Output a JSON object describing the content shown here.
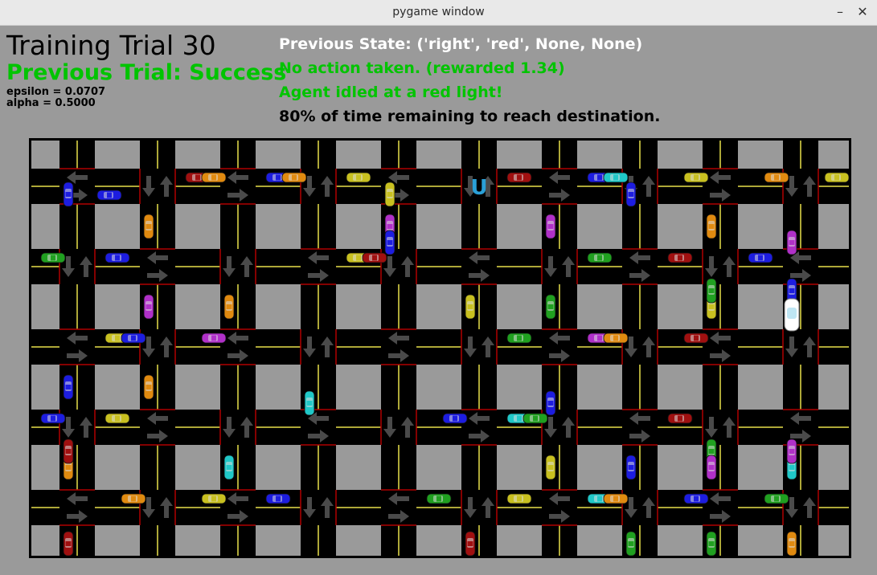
{
  "window": {
    "title": "pygame window",
    "minimize_glyph": "–",
    "close_glyph": "✕"
  },
  "hud": {
    "trial_title": "Training Trial 30",
    "previous_trial": "Previous Trial: Success",
    "epsilon": "epsilon = 0.0707",
    "alpha": "alpha = 0.5000",
    "previous_state": "Previous State: ('right', 'red', None, None)",
    "action": "No action taken. (rewarded 1.34)",
    "reason": "Agent idled at a red light!",
    "time_remaining": "80% of time remaining to reach destination."
  },
  "colors": {
    "background": "#9a9a9a",
    "road": "#000000",
    "lane_line": "#e8e04a",
    "signal_red": "#b00000",
    "success_green": "#00c400",
    "white_text": "#ffffff",
    "destination": "#2a9fd6"
  },
  "icons": {
    "destination": "udacity-logo-icon",
    "agent": "white-agent-car-icon",
    "traffic_arrow": "arrow-icon"
  },
  "world": {
    "columns": 10,
    "rows": 5,
    "agent_facing": "south",
    "destination_marker": "U"
  },
  "cars": [
    {
      "color": "#1d1de0",
      "dir": "v",
      "road": 0,
      "cross": 0.6
    },
    {
      "color": "#c8c020",
      "dir": "v",
      "road": 4,
      "cross": 0.6
    },
    {
      "color": "#1d1de0",
      "dir": "v",
      "road": 7,
      "cross": 0.6
    },
    {
      "color": "#1d1de0",
      "dir": "h",
      "road": 0,
      "cross": 0.9
    },
    {
      "color": "#a01010",
      "dir": "h",
      "road": 0,
      "cross": 2.0
    },
    {
      "color": "#1d1de0",
      "dir": "h",
      "road": 0,
      "cross": 3.0
    },
    {
      "color": "#c8c020",
      "dir": "h",
      "road": 0,
      "cross": 4.0
    },
    {
      "color": "#a01010",
      "dir": "h",
      "road": 0,
      "cross": 6.0
    },
    {
      "color": "#1d1de0",
      "dir": "h",
      "road": 0,
      "cross": 7.0
    },
    {
      "color": "#c8c020",
      "dir": "h",
      "road": 0,
      "cross": 10.0
    },
    {
      "color": "#e08a10",
      "dir": "h",
      "road": 0,
      "cross": 2.2
    },
    {
      "color": "#e08a10",
      "dir": "h",
      "road": 0,
      "cross": 3.2
    },
    {
      "color": "#20c8c8",
      "dir": "h",
      "road": 0,
      "cross": 7.2
    },
    {
      "color": "#c8c020",
      "dir": "h",
      "road": 0,
      "cross": 8.2
    },
    {
      "color": "#e08a10",
      "dir": "h",
      "road": 0,
      "cross": 9.2
    },
    {
      "color": "#e08a10",
      "dir": "v",
      "road": 1,
      "cross": 1.0
    },
    {
      "color": "#b030c8",
      "dir": "v",
      "road": 4,
      "cross": 1.0
    },
    {
      "color": "#1d1de0",
      "dir": "v",
      "road": 4,
      "cross": 1.2
    },
    {
      "color": "#b030c8",
      "dir": "v",
      "road": 6,
      "cross": 1.0
    },
    {
      "color": "#e08a10",
      "dir": "v",
      "road": 8,
      "cross": 1.0
    },
    {
      "color": "#b030c8",
      "dir": "v",
      "road": 9,
      "cross": 1.2
    },
    {
      "color": "#1d1de0",
      "dir": "h",
      "road": 1,
      "cross": 1.0
    },
    {
      "color": "#c8c020",
      "dir": "h",
      "road": 1,
      "cross": 4.0
    },
    {
      "color": "#20a020",
      "dir": "h",
      "road": 1,
      "cross": 7.0
    },
    {
      "color": "#a01010",
      "dir": "h",
      "road": 1,
      "cross": 8.0
    },
    {
      "color": "#1d1de0",
      "dir": "h",
      "road": 1,
      "cross": 9.0
    },
    {
      "color": "#20a020",
      "dir": "h",
      "road": 1,
      "cross": 0.2
    },
    {
      "color": "#a01010",
      "dir": "h",
      "road": 1,
      "cross": 4.2
    },
    {
      "color": "#b030c8",
      "dir": "v",
      "road": 1,
      "cross": 2.0
    },
    {
      "color": "#e08a10",
      "dir": "v",
      "road": 2,
      "cross": 2.0
    },
    {
      "color": "#c8c020",
      "dir": "v",
      "road": 5,
      "cross": 2.0
    },
    {
      "color": "#20a020",
      "dir": "v",
      "road": 6,
      "cross": 2.0
    },
    {
      "color": "#c8c020",
      "dir": "v",
      "road": 8,
      "cross": 2.0
    },
    {
      "color": "#20a020",
      "dir": "v",
      "road": 8,
      "cross": 1.8
    },
    {
      "color": "#1d1de0",
      "dir": "v",
      "road": 9,
      "cross": 1.8
    },
    {
      "color": "#c8c020",
      "dir": "h",
      "road": 2,
      "cross": 1.0
    },
    {
      "color": "#20a020",
      "dir": "h",
      "road": 2,
      "cross": 6.0
    },
    {
      "color": "#b030c8",
      "dir": "h",
      "road": 2,
      "cross": 7.0
    },
    {
      "color": "#1d1de0",
      "dir": "h",
      "road": 2,
      "cross": 1.2
    },
    {
      "color": "#b030c8",
      "dir": "h",
      "road": 2,
      "cross": 2.2
    },
    {
      "color": "#e08a10",
      "dir": "h",
      "road": 2,
      "cross": 7.2
    },
    {
      "color": "#a01010",
      "dir": "h",
      "road": 2,
      "cross": 8.2
    },
    {
      "color": "#1d1de0",
      "dir": "v",
      "road": 0,
      "cross": 3.0
    },
    {
      "color": "#e08a10",
      "dir": "v",
      "road": 1,
      "cross": 3.0
    },
    {
      "color": "#20c8c8",
      "dir": "v",
      "road": 3,
      "cross": 3.2
    },
    {
      "color": "#1d1de0",
      "dir": "v",
      "road": 6,
      "cross": 3.2
    },
    {
      "color": "#c8c020",
      "dir": "h",
      "road": 3,
      "cross": 1.0
    },
    {
      "color": "#20c8c8",
      "dir": "h",
      "road": 3,
      "cross": 6.0
    },
    {
      "color": "#a01010",
      "dir": "h",
      "road": 3,
      "cross": 8.0
    },
    {
      "color": "#1d1de0",
      "dir": "h",
      "road": 3,
      "cross": 0.2
    },
    {
      "color": "#1d1de0",
      "dir": "h",
      "road": 3,
      "cross": 5.2
    },
    {
      "color": "#20a020",
      "dir": "h",
      "road": 3,
      "cross": 6.2
    },
    {
      "color": "#e08a10",
      "dir": "v",
      "road": 0,
      "cross": 4.0
    },
    {
      "color": "#a01010",
      "dir": "v",
      "road": 0,
      "cross": 3.8
    },
    {
      "color": "#20c8c8",
      "dir": "v",
      "road": 2,
      "cross": 4.0
    },
    {
      "color": "#c8c020",
      "dir": "v",
      "road": 6,
      "cross": 4.0
    },
    {
      "color": "#1d1de0",
      "dir": "v",
      "road": 7,
      "cross": 4.0
    },
    {
      "color": "#20a020",
      "dir": "v",
      "road": 8,
      "cross": 3.8
    },
    {
      "color": "#b030c8",
      "dir": "v",
      "road": 8,
      "cross": 4.0
    },
    {
      "color": "#20c8c8",
      "dir": "v",
      "road": 9,
      "cross": 4.0
    },
    {
      "color": "#b030c8",
      "dir": "v",
      "road": 9,
      "cross": 3.8
    },
    {
      "color": "#1d1de0",
      "dir": "h",
      "road": 4,
      "cross": 3.0
    },
    {
      "color": "#20a020",
      "dir": "h",
      "road": 4,
      "cross": 5.0
    },
    {
      "color": "#c8c020",
      "dir": "h",
      "road": 4,
      "cross": 6.0
    },
    {
      "color": "#20c8c8",
      "dir": "h",
      "road": 4,
      "cross": 7.0
    },
    {
      "color": "#e08a10",
      "dir": "h",
      "road": 4,
      "cross": 1.2
    },
    {
      "color": "#c8c020",
      "dir": "h",
      "road": 4,
      "cross": 2.2
    },
    {
      "color": "#e08a10",
      "dir": "h",
      "road": 4,
      "cross": 7.2
    },
    {
      "color": "#1d1de0",
      "dir": "h",
      "road": 4,
      "cross": 8.2
    },
    {
      "color": "#20a020",
      "dir": "h",
      "road": 4,
      "cross": 9.2
    },
    {
      "color": "#a01010",
      "dir": "v",
      "road": 0,
      "cross": 5.0
    },
    {
      "color": "#a01010",
      "dir": "v",
      "road": 5,
      "cross": 5.0
    },
    {
      "color": "#20a020",
      "dir": "v",
      "road": 7,
      "cross": 5.0
    },
    {
      "color": "#20a020",
      "dir": "v",
      "road": 8,
      "cross": 5.0
    },
    {
      "color": "#e08a10",
      "dir": "v",
      "road": 9,
      "cross": 5.0
    }
  ]
}
